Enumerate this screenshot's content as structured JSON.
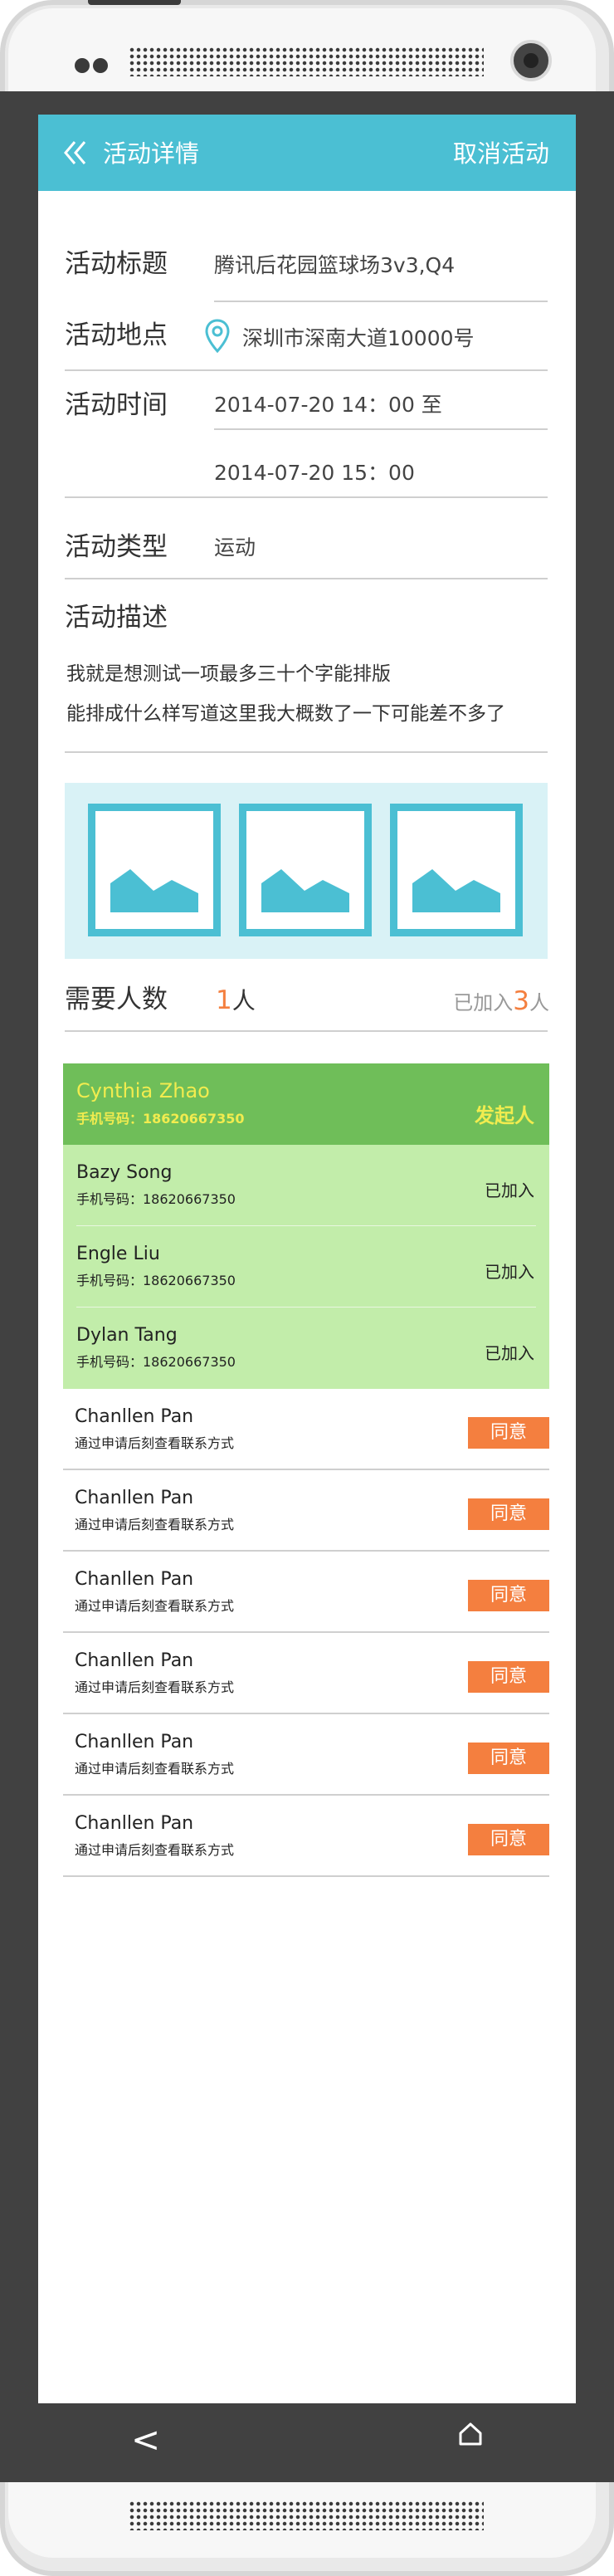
{
  "header": {
    "title": "活动详情",
    "cancel": "取消活动"
  },
  "details": {
    "title_label": "活动标题",
    "title_value": "腾讯后花园篮球场3v3,Q4",
    "location_label": "活动地点",
    "location_value": "深圳市深南大道10000号",
    "time_label": "活动时间",
    "time_start": "2014-07-20 14：00 至",
    "time_end": "2014-07-20 15：00",
    "type_label": "活动类型",
    "type_value": "运动",
    "desc_label": "活动描述",
    "desc_lines": [
      "我就是想测试一项最多三十个字能排版",
      "能排成什么样写道这里我大概数了一下可能差不多了"
    ]
  },
  "people": {
    "need_label": "需要人数",
    "need_num": "1",
    "need_unit": "人",
    "joined_prefix": "已加入",
    "joined_num": "3",
    "joined_suffix": "人"
  },
  "organizer": {
    "name": "Cynthia Zhao",
    "phone": "手机号码：18620667350",
    "role": "发起人"
  },
  "members": [
    {
      "name": "Bazy Song",
      "phone": "手机号码：18620667350",
      "status": "已加入"
    },
    {
      "name": "Engle Liu",
      "phone": "手机号码：18620667350",
      "status": "已加入"
    },
    {
      "name": "Dylan Tang",
      "phone": "手机号码：18620667350",
      "status": "已加入"
    }
  ],
  "applicants": [
    {
      "name": "Chanllen Pan",
      "note": "通过申请后刻查看联系方式",
      "action": "同意"
    },
    {
      "name": "Chanllen Pan",
      "note": "通过申请后刻查看联系方式",
      "action": "同意"
    },
    {
      "name": "Chanllen Pan",
      "note": "通过申请后刻查看联系方式",
      "action": "同意"
    },
    {
      "name": "Chanllen Pan",
      "note": "通过申请后刻查看联系方式",
      "action": "同意"
    },
    {
      "name": "Chanllen Pan",
      "note": "通过申请后刻查看联系方式",
      "action": "同意"
    },
    {
      "name": "Chanllen Pan",
      "note": "通过申请后刻查看联系方式",
      "action": "同意"
    }
  ],
  "softkeys": {
    "back": "<"
  },
  "colors": {
    "accent": "#4bbfd3",
    "organizer": "#6fbe59",
    "member": "#c2edaa",
    "agree": "#f47f3f",
    "highlight": "#f1ec4f"
  },
  "icons": [
    "chevron-left-icon",
    "location-pin-icon",
    "image-placeholder-icon",
    "home-icon"
  ]
}
